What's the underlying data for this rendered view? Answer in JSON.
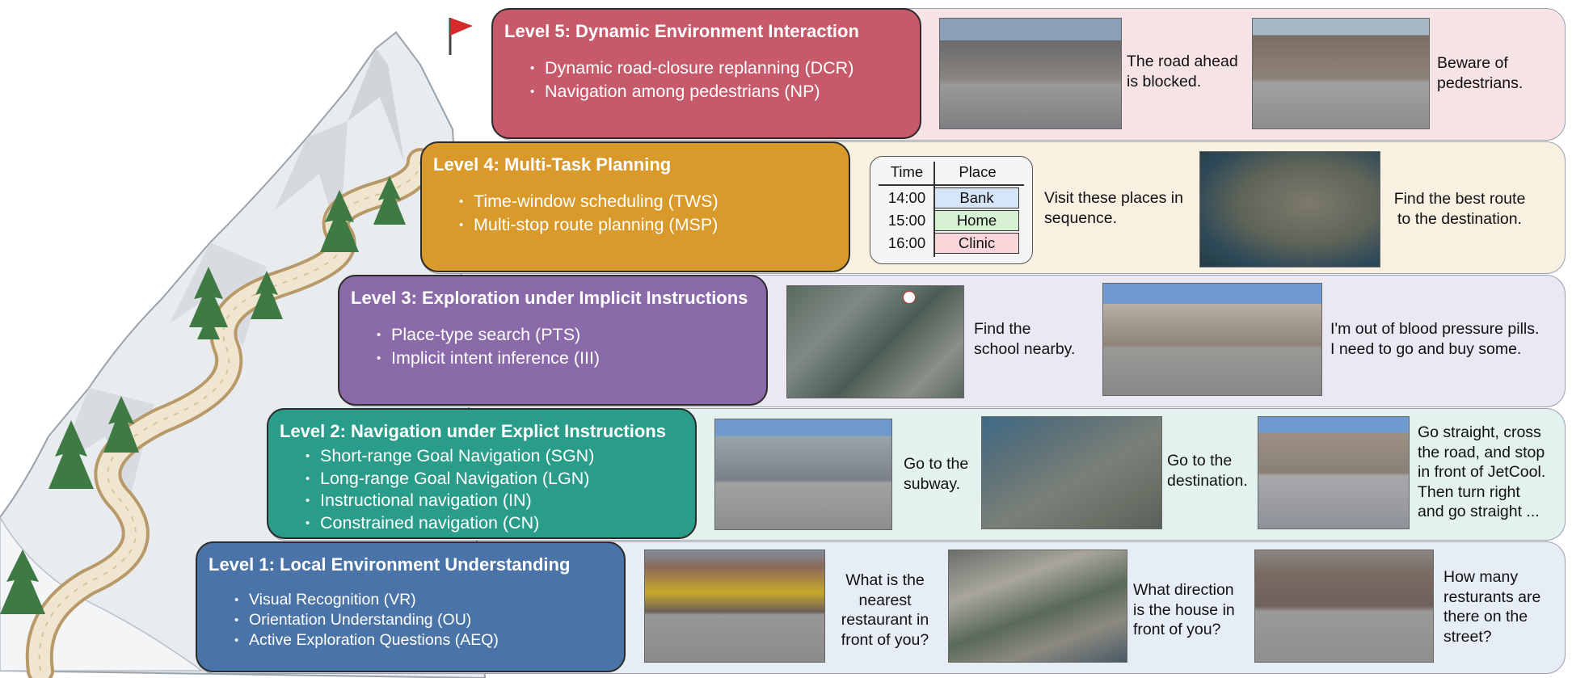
{
  "levels": [
    {
      "title": "Level 1: Local Environment Understanding",
      "items": [
        "Visual Recognition (VR)",
        "Orientation Understanding (OU)",
        "Active Exploration Questions (AEQ)"
      ],
      "color": "#4a74a7"
    },
    {
      "title": "Level 2: Navigation under Explict Instructions",
      "items": [
        "Short-range Goal Navigation (SGN)",
        "Long-range Goal Navigation (LGN)",
        "Instructional navigation (IN)",
        "Constrained navigation (CN)"
      ],
      "color": "#2a9d8a"
    },
    {
      "title": "Level 3: Exploration under Implicit Instructions",
      "items": [
        "Place-type search (PTS)",
        "Implicit intent inference (III)"
      ],
      "color": "#8a6aa8"
    },
    {
      "title": "Level 4: Multi-Task Planning",
      "items": [
        "Time-window scheduling (TWS)",
        "Multi-stop route planning (MSP)"
      ],
      "color": "#d99a2b"
    },
    {
      "title": "Level 5: Dynamic Environment Interaction",
      "items": [
        "Dynamic road-closure replanning (DCR)",
        "Navigation among pedestrians (NP)"
      ],
      "color": "#c75a6a"
    }
  ],
  "captions": {
    "l5_a": [
      "The road ahead",
      "is blocked."
    ],
    "l5_b": [
      "Beware of",
      "pedestrians."
    ],
    "l4_a": [
      "Visit these places in",
      "sequence."
    ],
    "l4_b": [
      "Find the best route",
      "to the destination."
    ],
    "l3_a": [
      "Find the",
      "school nearby."
    ],
    "l3_b": [
      "I'm out of blood pressure pills.",
      "I need to go and buy some."
    ],
    "l2_a": [
      "Go to the",
      "subway."
    ],
    "l2_b": [
      "Go to the",
      "destination."
    ],
    "l2_c": [
      "Go straight, cross",
      "the road, and stop",
      "in front of JetCool.",
      "Then turn right",
      "and go straight ..."
    ],
    "l1_a": [
      "What is the",
      "nearest",
      "restaurant in",
      "front of you?"
    ],
    "l1_b": [
      "What direction",
      "is the house in",
      "front of you?"
    ],
    "l1_c": [
      "How many",
      "resturants are",
      "there on the",
      "street?"
    ]
  },
  "schedule": {
    "headers": [
      "Time",
      "Place"
    ],
    "rows": [
      {
        "time": "14:00",
        "place": "Bank",
        "color": "#d6e6f8"
      },
      {
        "time": "15:00",
        "place": "Home",
        "color": "#d6f0d4"
      },
      {
        "time": "16:00",
        "place": "Clinic",
        "color": "#f8d6da"
      }
    ]
  },
  "panel_colors": {
    "l5": "#f6e3e6",
    "l4": "#f8f0e0",
    "l3": "#ece8f3",
    "l2": "#e3f2ef",
    "l1": "#e6edf5"
  },
  "icons": [
    "summit-flag-icon",
    "school-marker-icon"
  ]
}
